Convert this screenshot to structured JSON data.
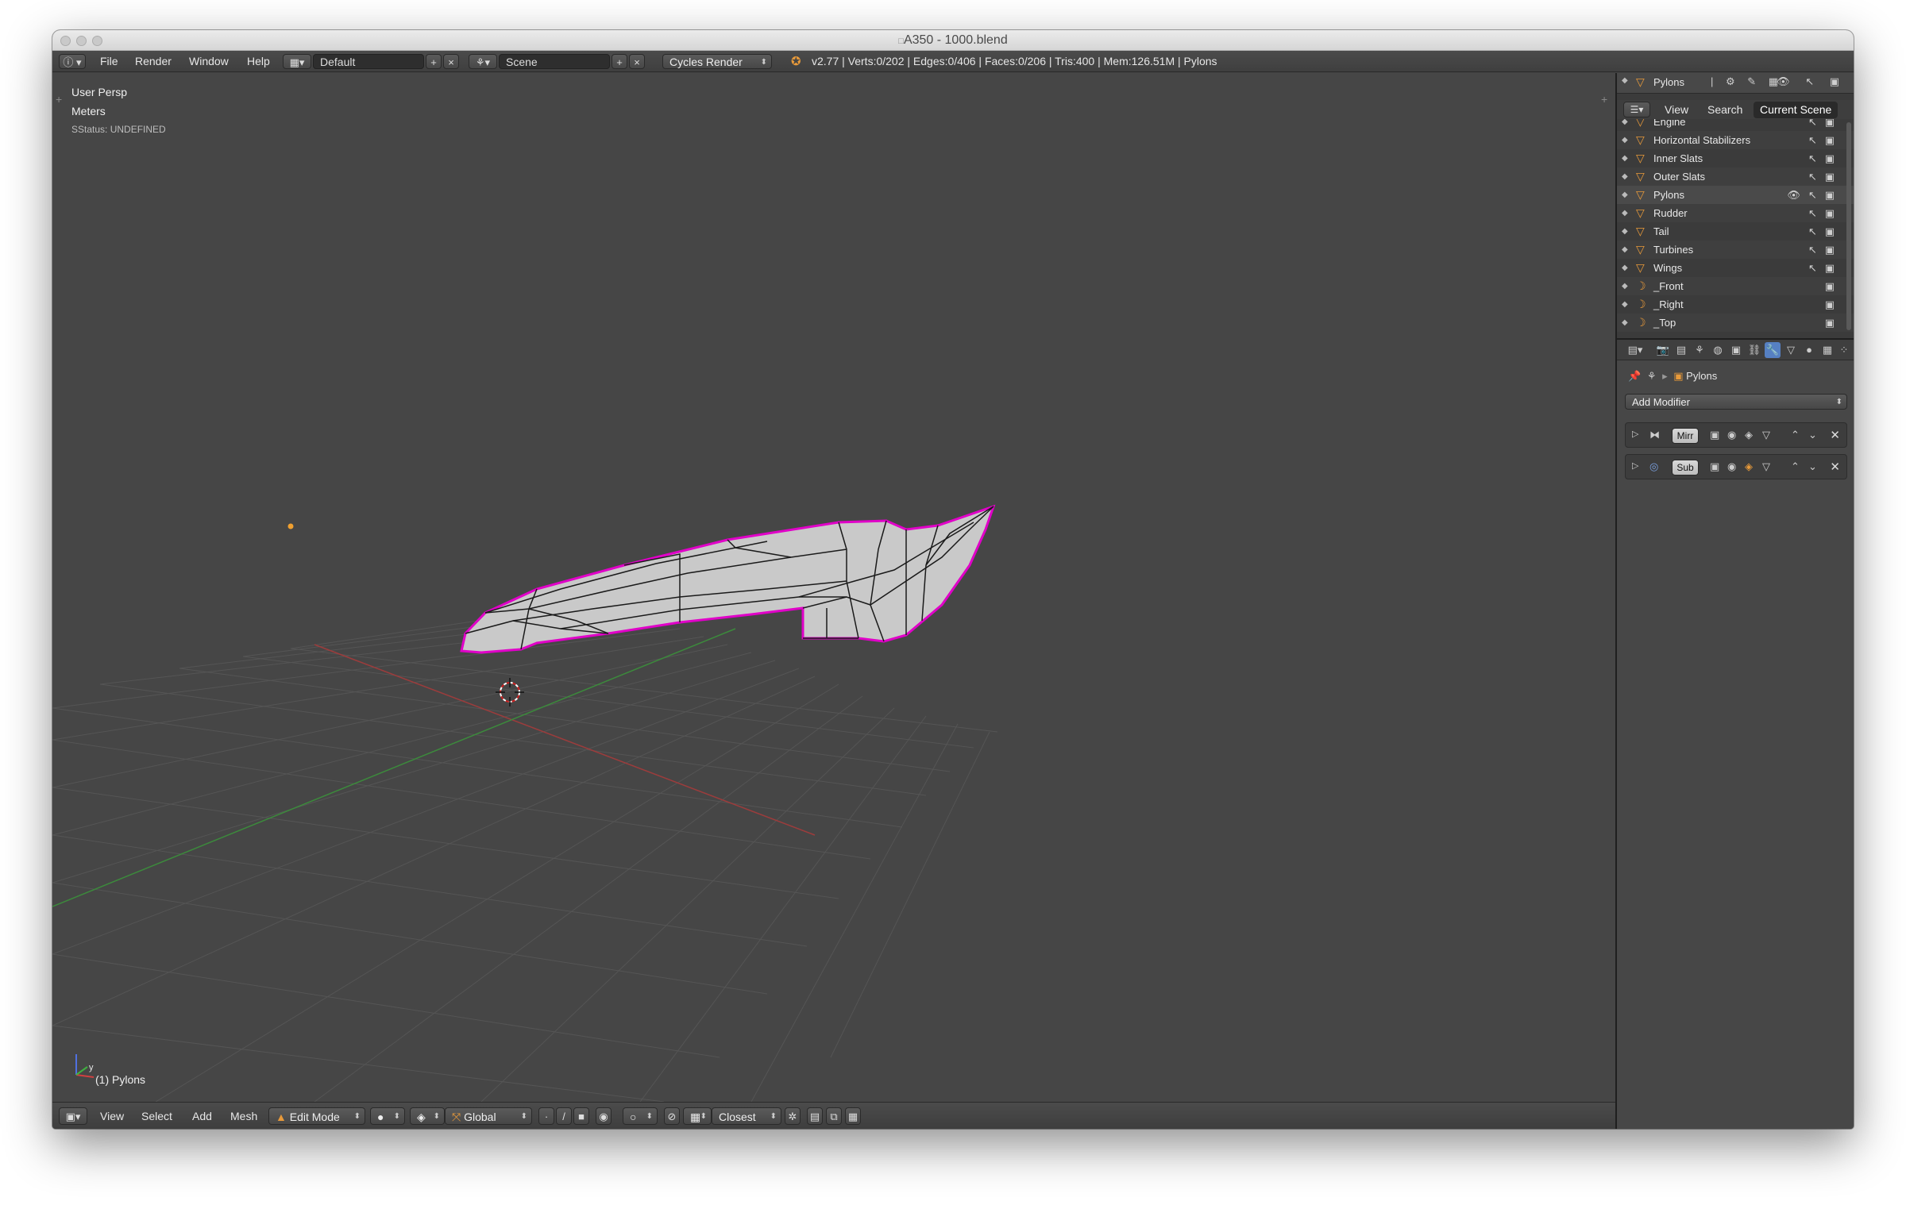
{
  "window": {
    "title": "A350 - 1000.blend"
  },
  "infobar": {
    "menus": [
      "File",
      "Render",
      "Window",
      "Help"
    ],
    "screen_layout": "Default",
    "scene": "Scene",
    "render_engine": "Cycles Render",
    "stats": "v2.77 | Verts:0/202 | Edges:0/406 | Faces:0/206 | Tris:400 | Mem:126.51M | Pylons"
  },
  "viewport": {
    "view_name": "User Persp",
    "units": "Meters",
    "status": "SStatus: UNDEFINED",
    "object_label": "(1) Pylons"
  },
  "footer": {
    "menus": [
      "View",
      "Select",
      "Add",
      "Mesh"
    ],
    "mode": "Edit Mode",
    "orientation": "Global",
    "snap_target": "Closest"
  },
  "outliner": {
    "active_object": "Pylons",
    "tabs": [
      "View",
      "Search",
      "Current Scene"
    ],
    "items": [
      {
        "name": "Engine",
        "icon": "mesh-icon"
      },
      {
        "name": "Horizontal Stabilizers",
        "icon": "mesh-icon"
      },
      {
        "name": "Inner Slats",
        "icon": "mesh-icon"
      },
      {
        "name": "Outer Slats",
        "icon": "mesh-icon"
      },
      {
        "name": "Pylons",
        "icon": "mesh-icon"
      },
      {
        "name": "Rudder",
        "icon": "mesh-icon"
      },
      {
        "name": "Tail",
        "icon": "mesh-icon"
      },
      {
        "name": "Turbines",
        "icon": "mesh-icon"
      },
      {
        "name": "Wings",
        "icon": "mesh-icon"
      },
      {
        "name": "_Front",
        "icon": "camera-icon"
      },
      {
        "name": "_Right",
        "icon": "camera-icon"
      },
      {
        "name": "_Top",
        "icon": "camera-icon"
      }
    ]
  },
  "properties": {
    "breadcrumb_object": "Pylons",
    "add_modifier": "Add Modifier",
    "modifiers": [
      {
        "name": "Mirr"
      },
      {
        "name": "Sub"
      }
    ]
  },
  "colors": {
    "viewport_bg": "#464646",
    "selection_outline": "#e000c8",
    "mesh_fill": "#c8c8c8",
    "x_axis": "#b23a3a",
    "y_axis": "#3a8a3a"
  }
}
